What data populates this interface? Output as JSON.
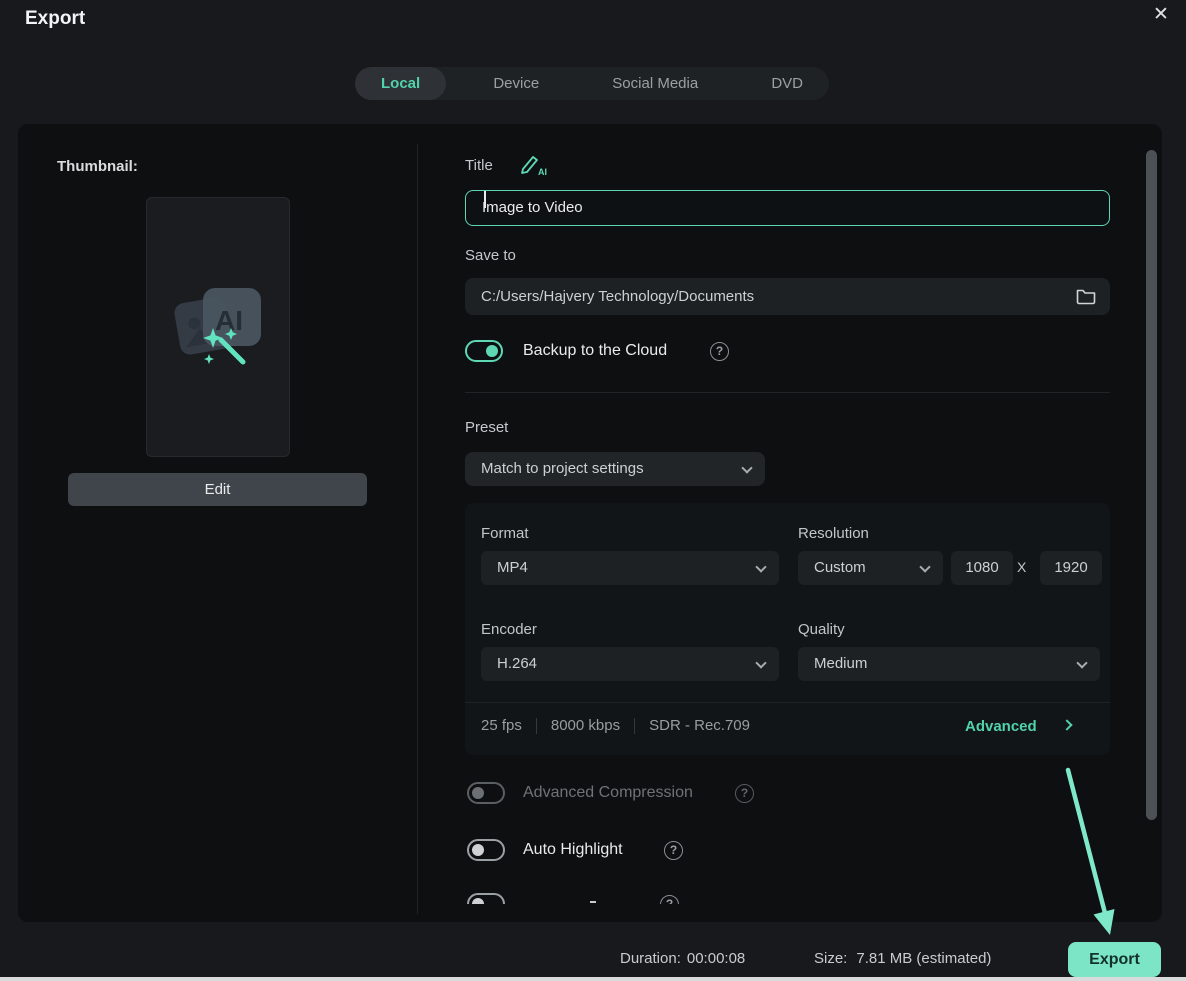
{
  "colors": {
    "accent": "#5ed8b2",
    "export_button": "#7ce5c5",
    "arrow": "#7fe8c8"
  },
  "header": {
    "title": "Export",
    "close_icon": "close-icon"
  },
  "tabs": [
    {
      "label": "Local",
      "active": true
    },
    {
      "label": "Device",
      "active": false
    },
    {
      "label": "Social Media",
      "active": false
    },
    {
      "label": "DVD",
      "active": false
    }
  ],
  "thumbnail": {
    "label": "Thumbnail:",
    "icon_text": "AI",
    "edit_button": "Edit"
  },
  "form": {
    "title": {
      "label": "Title",
      "value": "Image to Video"
    },
    "save_to": {
      "label": "Save to",
      "value": "C:/Users/Hajvery Technology/Documents"
    },
    "backup": {
      "label": "Backup to the Cloud",
      "enabled": true
    },
    "preset": {
      "label": "Preset",
      "value": "Match to project settings"
    },
    "format": {
      "label": "Format",
      "value": "MP4"
    },
    "resolution": {
      "label": "Resolution",
      "value": "Custom",
      "width": "1080",
      "separator": "X",
      "height": "1920"
    },
    "encoder": {
      "label": "Encoder",
      "value": "H.264"
    },
    "quality": {
      "label": "Quality",
      "value": "Medium"
    },
    "stream_info": {
      "fps": "25 fps",
      "bitrate": "8000 kbps",
      "color_space": "SDR - Rec.709"
    },
    "advanced": {
      "label": "Advanced"
    },
    "advanced_compression": {
      "label": "Advanced Compression",
      "enabled": false
    },
    "auto_highlight": {
      "label": "Auto Highlight",
      "enabled": false
    }
  },
  "footer": {
    "duration_label": "Duration:",
    "duration_value": "00:00:08",
    "size_label": "Size:",
    "size_value": "7.81 MB (estimated)",
    "export_button": "Export"
  }
}
